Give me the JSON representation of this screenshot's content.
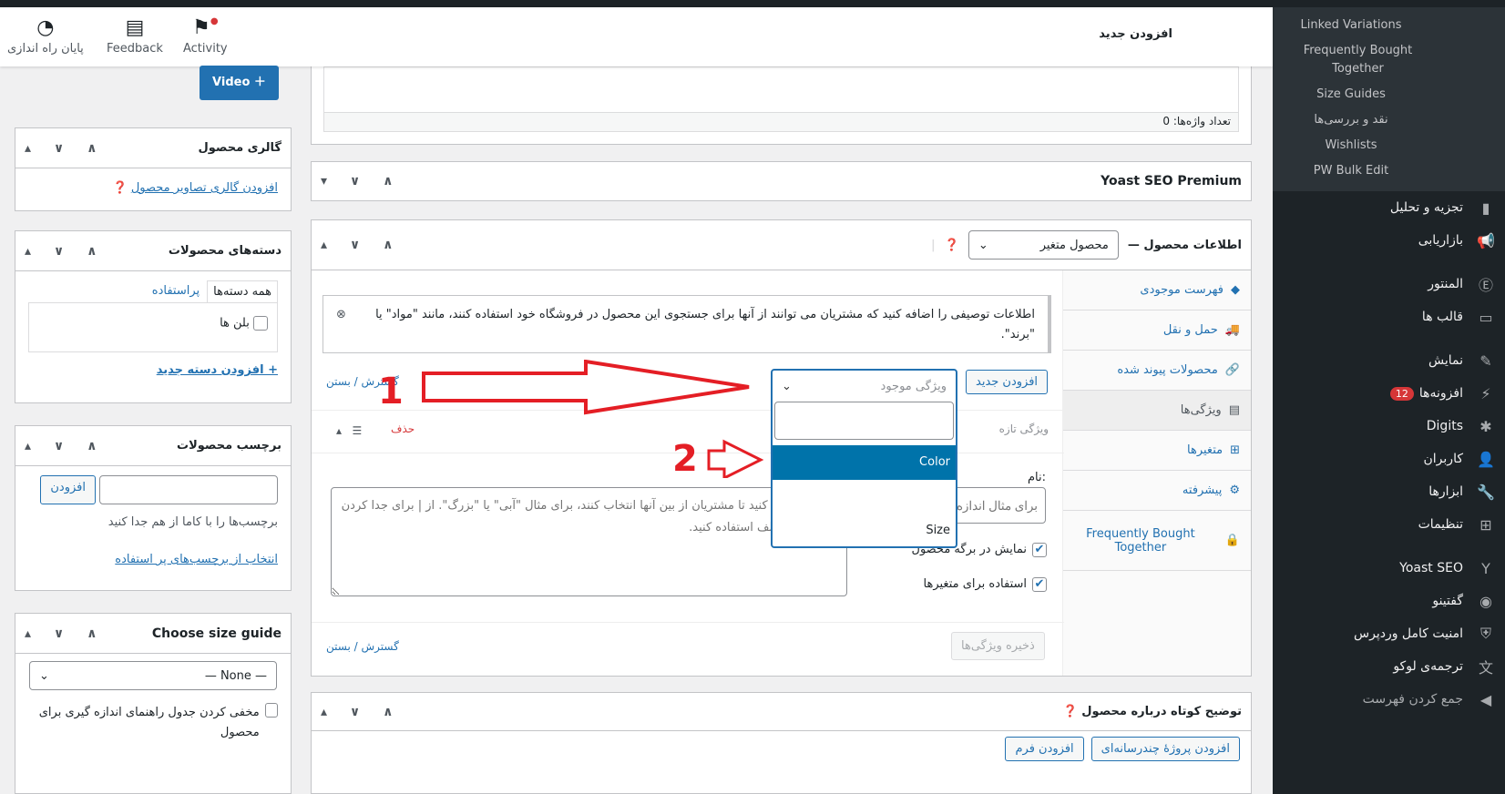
{
  "header": {
    "title": "افزودن جدید",
    "buttons": [
      {
        "label": "پایان راه اندازی",
        "icon": "clock-icon"
      },
      {
        "label": "Feedback",
        "icon": "feedback-icon"
      },
      {
        "label": "Activity",
        "icon": "flag-icon"
      }
    ]
  },
  "sidebar": {
    "submenu": [
      "Linked Variations",
      "Frequently Bought Together",
      "Size Guides",
      "نقد و بررسی‌ها",
      "Wishlists",
      "PW Bulk Edit"
    ],
    "items": [
      {
        "label": "تجزیه و تحلیل",
        "icon": "chart-icon"
      },
      {
        "label": "بازاریابی",
        "icon": "megaphone-icon"
      },
      {
        "label": "المنتور",
        "icon": "elementor-icon"
      },
      {
        "label": "قالب ها",
        "icon": "folder-icon"
      },
      {
        "label": "نمایش",
        "icon": "brush-icon"
      },
      {
        "label": "افزونه‌ها",
        "icon": "plugin-icon",
        "badge": "12"
      },
      {
        "label": "Digits",
        "icon": "digits-icon"
      },
      {
        "label": "کاربران",
        "icon": "user-icon"
      },
      {
        "label": "ابزارها",
        "icon": "wrench-icon"
      },
      {
        "label": "تنظیمات",
        "icon": "settings-icon"
      },
      {
        "label": "Yoast SEO",
        "icon": "yoast-icon"
      },
      {
        "label": "گفتینو",
        "icon": "chat-icon"
      },
      {
        "label": "امنیت کامل وردپرس",
        "icon": "shield-icon"
      },
      {
        "label": "ترجمه‌ی لوکو",
        "icon": "translate-icon"
      },
      {
        "label": "جمع کردن فهرست",
        "icon": "collapse-icon"
      }
    ]
  },
  "left": {
    "video_button": "Video",
    "gallery": {
      "title": "گالری محصول",
      "link": "افزودن گالری تصاویر محصول"
    },
    "categories": {
      "title": "دسته‌های محصولات",
      "tab_all": "همه دسته‌ها",
      "tab_popular": "پراستفاده",
      "items": [
        "بلن ها"
      ],
      "add_link": "+ افزودن دسته جدید"
    },
    "tags": {
      "title": "برچسب محصولات",
      "add_button": "افزودن",
      "hint": "برچسب‌ها را با کاما از هم جدا کنید",
      "choose_link": "انتخاب از برچسب‌های پر استفاده"
    },
    "size_guide": {
      "title": "Choose size guide",
      "selected": "— None —",
      "hide_label": "مخفی کردن جدول راهنمای اندازه گیری برای محصول"
    }
  },
  "main": {
    "word_count": "تعداد واژه‌ها: 0",
    "yoast_title": "Yoast SEO Premium",
    "product_data": {
      "title": "اطلاعات محصول —",
      "type": "محصول متغیر",
      "tabs": [
        "فهرست موجودی",
        "حمل و نقل",
        "محصولات پیوند شده",
        "ویژگی‌ها",
        "متغیرها",
        "پیشرفته",
        "Frequently Bought Together"
      ],
      "notice": "اطلاعات توصیفی را اضافه کنید که مشتریان می توانند از آنها برای جستجوی این محصول در فروشگاه خود استفاده کنند، مانند \"مواد\" یا \"برند\".",
      "add_new": "افزودن جدید",
      "attr_placeholder": "ویژگی موجود",
      "expand_close": "گسترش / بستن",
      "new_attr": "ویژگی تازه",
      "delete": "حذف",
      "name_label": "نام:",
      "name_placeholder": "برای مثال اندازه",
      "values_placeholder": "مقادیر را وارد کنید تا مشتریان از بین آنها انتخاب کنند، برای مثال \"آبی\" یا \"بزرگ\". از | برای جدا کردن گزینه‌های مختلف استفاده کنید.",
      "visible_label": "نمایش در برگه محصول",
      "variations_label": "استفاده برای متغیرها",
      "save": "ذخیره ویژگی‌ها",
      "dropdown_options": [
        "Color",
        "",
        "Size"
      ],
      "annotations": [
        "1",
        "2"
      ]
    },
    "short_desc": {
      "title": "توضیح کوتاه درباره محصول",
      "btn1": "افزودن پروژهٔ چندرسانه‌ای",
      "btn2": "افزودن فرم"
    }
  },
  "colors": {
    "accent": "#2271b1",
    "highlight": "#0073aa",
    "annotation": "#e41e25"
  }
}
